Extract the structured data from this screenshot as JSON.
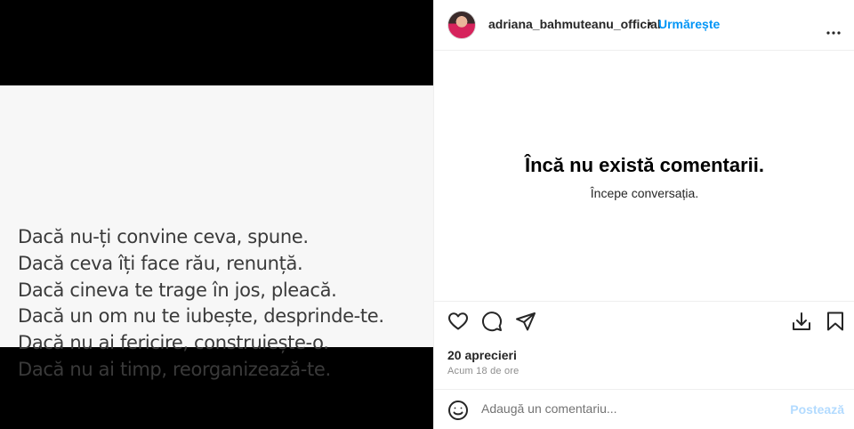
{
  "post": {
    "quote_lines": [
      "Dacă nu-ți convine ceva, spune.",
      "Dacă ceva îți face rău, renunță.",
      "Dacă cineva te trage în jos, pleacă.",
      "Dacă un om nu te iubește, desprinde-te.",
      "Dacă nu ai fericire, construiește-o.",
      "Dacă nu ai timp, reorganizează-te."
    ]
  },
  "header": {
    "username": "adriana_bahmuteanu_official",
    "separator": "•",
    "follow_label": "Urmărește",
    "more_icon": "more-horizontal-icon"
  },
  "comments": {
    "empty_title": "Încă nu există comentarii.",
    "empty_subtitle": "Începe conversația."
  },
  "actions": {
    "like_icon": "heart-icon",
    "comment_icon": "comment-icon",
    "share_icon": "send-icon",
    "download_icon": "download-icon",
    "save_icon": "bookmark-icon",
    "likes_text": "20 aprecieri",
    "timestamp": "Acum 18 de ore"
  },
  "comment_box": {
    "emoji_icon": "emoji-icon",
    "placeholder": "Adaugă un comentariu...",
    "post_label": "Postează"
  },
  "colors": {
    "accent": "#0095f6",
    "post_disabled": "#b3dbff",
    "media_background": "#000000",
    "photo_background": "#f7f7f7"
  }
}
